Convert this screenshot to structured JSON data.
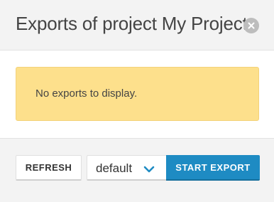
{
  "dialog": {
    "title": "Exports of project My Project",
    "close_icon": "close-icon"
  },
  "body": {
    "empty_message": "No exports to display."
  },
  "footer": {
    "refresh_label": "REFRESH",
    "format_select": {
      "selected": "default",
      "icon": "chevron-down-icon"
    },
    "start_export_label": "START EXPORT"
  },
  "colors": {
    "alert_background": "#fde08c",
    "primary_button": "#1e8bc3",
    "chevron": "#1e8bc3"
  }
}
